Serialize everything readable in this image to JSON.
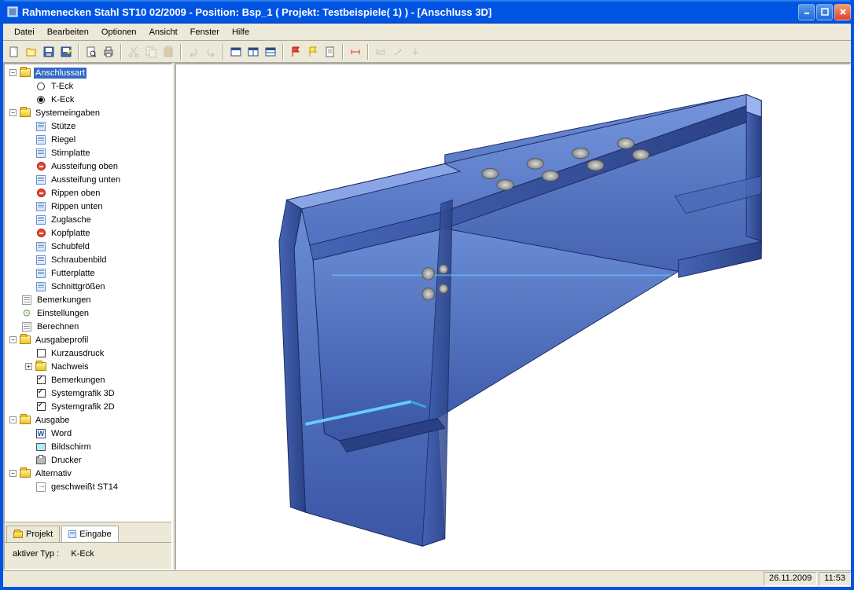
{
  "title": "Rahmenecken Stahl ST10 02/2009 - Position: Bsp_1 ( Projekt: Testbeispiele( 1) ) - [Anschluss 3D]",
  "menu": {
    "datei": "Datei",
    "bearbeiten": "Bearbeiten",
    "optionen": "Optionen",
    "ansicht": "Ansicht",
    "fenster": "Fenster",
    "hilfe": "Hilfe"
  },
  "tree": {
    "anschlussart": "Anschlussart",
    "t_eck": "T-Eck",
    "k_eck": "K-Eck",
    "systemeingaben": "Systemeingaben",
    "stuetze": "Stütze",
    "riegel": "Riegel",
    "stirnplatte": "Stirnplatte",
    "aussteifung_oben": "Aussteifung oben",
    "aussteifung_unten": "Aussteifung unten",
    "rippen_oben": "Rippen oben",
    "rippen_unten": "Rippen unten",
    "zuglasche": "Zuglasche",
    "kopfplatte": "Kopfplatte",
    "schubfeld": "Schubfeld",
    "schraubenbild": "Schraubenbild",
    "futterplatte": "Futterplatte",
    "schnittgroessen": "Schnittgrößen",
    "bemerkungen": "Bemerkungen",
    "einstellungen": "Einstellungen",
    "berechnen": "Berechnen",
    "ausgabeprofil": "Ausgabeprofil",
    "kurzausdruck": "Kurzausdruck",
    "nachweis": "Nachweis",
    "bemerkungen2": "Bemerkungen",
    "systemgrafik_3d": "Systemgrafik 3D",
    "systemgrafik_2d": "Systemgrafik 2D",
    "ausgabe": "Ausgabe",
    "word": "Word",
    "bildschirm": "Bildschirm",
    "drucker": "Drucker",
    "alternativ": "Alternativ",
    "geschweisst": "geschweißt ST14"
  },
  "tabs": {
    "projekt": "Projekt",
    "eingabe": "Eingabe"
  },
  "status": {
    "aktiver_typ_label": "aktiver Typ :",
    "aktiver_typ_value": "K-Eck"
  },
  "statusbar": {
    "date": "26.11.2009",
    "time": "11:53"
  }
}
